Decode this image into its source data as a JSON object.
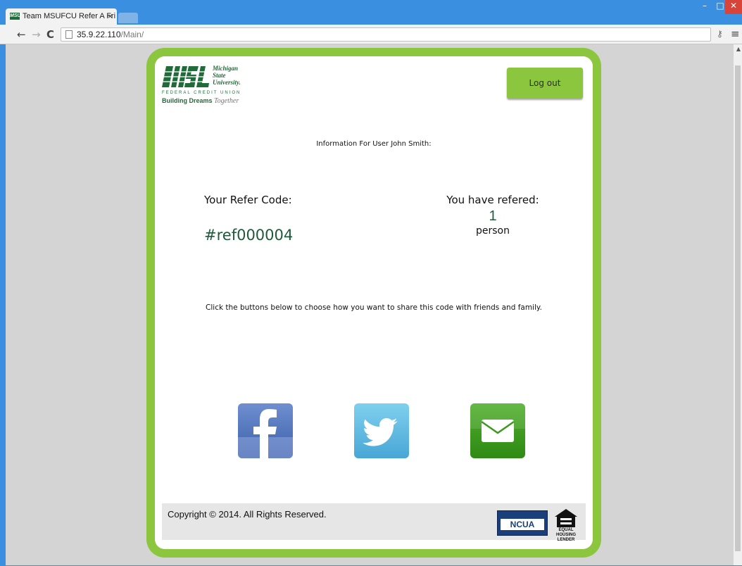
{
  "browser": {
    "tab_title": "Team MSUFCU Refer A Fri",
    "tab_favicon_text": "MSU",
    "tab_close": "×",
    "url_host": "35.9.22.110",
    "url_path": "/Main/",
    "window_controls": {
      "minimize": "–",
      "maximize": "□",
      "close": "✕"
    },
    "nav": {
      "back": "←",
      "forward": "→",
      "reload": "C"
    }
  },
  "logo": {
    "word_1": "Michigan",
    "word_2": "State",
    "word_3": "University.",
    "subtitle": "FEDERAL CREDIT UNION",
    "tagline_main": "Building Dreams",
    "tagline_script": "Together"
  },
  "header": {
    "logout_label": "Log out"
  },
  "user_info": "Information For User John Smith:",
  "refer": {
    "code_label": "Your Refer Code:",
    "code_value": "#ref000004"
  },
  "referrals": {
    "label": "You have refered:",
    "count": "1",
    "unit": "person"
  },
  "share_instructions": "Click the buttons below to choose how you want to share this code with friends and family.",
  "share_buttons": [
    {
      "service": "facebook",
      "icon": "facebook-icon",
      "color": "#3b5998"
    },
    {
      "service": "twitter",
      "icon": "twitter-icon",
      "color": "#55acee"
    },
    {
      "service": "email",
      "icon": "envelope-icon",
      "color": "#3a9a1c"
    }
  ],
  "footer": {
    "copyright": "Copyright © 2014. All Rights Reserved.",
    "ncua_label": "NCUA",
    "ehl_line_1": "EQUAL HOUSING",
    "ehl_line_2": "LENDER"
  },
  "colors": {
    "brand_green": "#8cc63f",
    "dark_green": "#1f5a3d",
    "chrome_blue": "#3b8fe0"
  }
}
